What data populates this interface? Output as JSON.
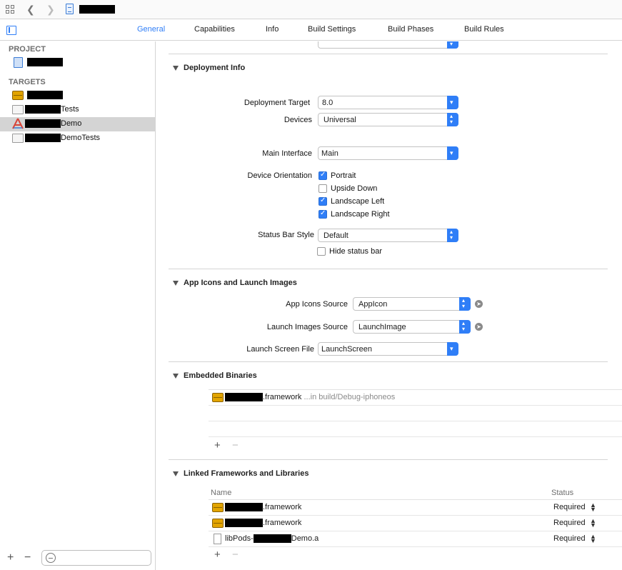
{
  "toolbar": {
    "back_icon": "chevron-left-icon",
    "forward_icon": "chevron-right-icon",
    "grid_icon": "grid-icon",
    "file_icon": "project-file-icon"
  },
  "tabs": [
    {
      "label": "General"
    },
    {
      "label": "Capabilities"
    },
    {
      "label": "Info"
    },
    {
      "label": "Build Settings"
    },
    {
      "label": "Build Phases"
    },
    {
      "label": "Build Rules"
    }
  ],
  "active_tab": "General",
  "sidebar": {
    "project_heading": "PROJECT",
    "targets_heading": "TARGETS",
    "targets": [
      {
        "suffix": ""
      },
      {
        "suffix": "Tests"
      },
      {
        "suffix": "Demo"
      },
      {
        "suffix": "DemoTests"
      }
    ],
    "add_label": "+",
    "remove_label": "−"
  },
  "deployment": {
    "title": "Deployment Info",
    "deployment_target_label": "Deployment Target",
    "deployment_target_value": "8.0",
    "devices_label": "Devices",
    "devices_value": "Universal",
    "main_interface_label": "Main Interface",
    "main_interface_value": "Main",
    "orientation_label": "Device Orientation",
    "orientations": [
      {
        "label": "Portrait",
        "checked": true
      },
      {
        "label": "Upside Down",
        "checked": false
      },
      {
        "label": "Landscape Left",
        "checked": true
      },
      {
        "label": "Landscape Right",
        "checked": true
      }
    ],
    "status_bar_style_label": "Status Bar Style",
    "status_bar_style_value": "Default",
    "hide_status_bar_label": "Hide status bar",
    "hide_status_bar_checked": false
  },
  "app_icons": {
    "title": "App Icons and Launch Images",
    "icons_source_label": "App Icons Source",
    "icons_source_value": "AppIcon",
    "launch_images_label": "Launch Images Source",
    "launch_images_value": "LaunchImage",
    "launch_screen_label": "Launch Screen File",
    "launch_screen_value": "LaunchScreen"
  },
  "embedded": {
    "title": "Embedded Binaries",
    "items": [
      {
        "name": ".framework",
        "location": "...in build/Debug-iphoneos"
      }
    ],
    "add_label": "+",
    "remove_label": "−"
  },
  "linked": {
    "title": "Linked Frameworks and Libraries",
    "col_name": "Name",
    "col_status": "Status",
    "items": [
      {
        "prefix": "",
        "name": ".framework",
        "status": "Required"
      },
      {
        "prefix": "",
        "name": ".framework",
        "status": "Required"
      },
      {
        "prefix": "libPods-",
        "name": "Demo.a",
        "status": "Required"
      }
    ],
    "add_label": "+",
    "remove_label": "−"
  },
  "colors": {
    "accent": "#2f7ef7",
    "selection": "#d4d4d4",
    "toolbox": "#e2a400"
  }
}
